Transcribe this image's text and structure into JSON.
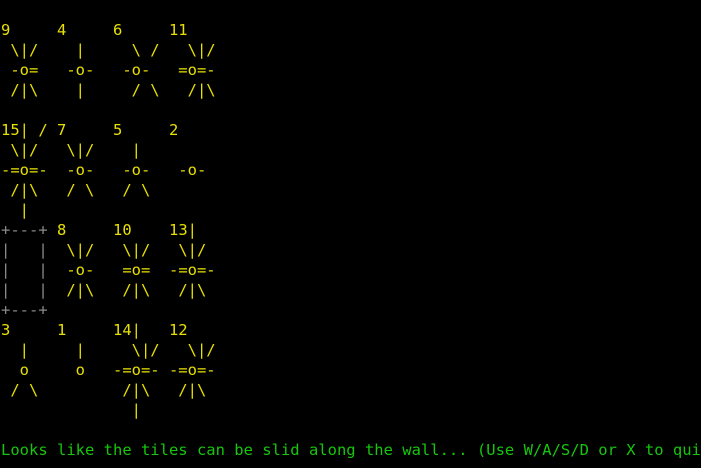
{
  "colors": {
    "background": "#000000",
    "tile_text": "#e8e000",
    "wall": "#8a8a8a",
    "status_text": "#16c60c"
  },
  "board": {
    "rows": [
      [
        {
          "text": "9     4     6     11",
          "type": "tile"
        },
        {
          "text": " \\|/    |     \\ /   \\|/",
          "type": "tile"
        },
        {
          "text": " -o=   -o-   -o-   =o=-",
          "type": "tile"
        },
        {
          "text": " /|\\    |     / \\   /|\\",
          "type": "tile"
        },
        {
          "text": "",
          "type": "tile"
        }
      ],
      [
        {
          "text": "15| / 7     5     2",
          "type": "tile"
        },
        {
          "text": " \\|/   \\|/    |",
          "type": "tile"
        },
        {
          "text": "-=o=-  -o-   -o-   -o-",
          "type": "tile"
        },
        {
          "text": " /|\\   / \\   / \\",
          "type": "tile"
        },
        {
          "text": "  |",
          "type": "tile"
        }
      ],
      [
        {
          "text": "+---+",
          "type": "wall",
          "rest": " 8     10    13|"
        },
        {
          "text": "|   |",
          "type": "wall",
          "rest": "  \\|/   \\|/   \\|/"
        },
        {
          "text": "|   |",
          "type": "wall",
          "rest": "  -o-   =o=  -=o=-"
        },
        {
          "text": "|   |",
          "type": "wall",
          "rest": "  /|\\   /|\\   /|\\"
        },
        {
          "text": "+---+",
          "type": "wall",
          "rest": ""
        }
      ],
      [
        {
          "text": "3     1     14|   12",
          "type": "tile"
        },
        {
          "text": "  |     |     \\|/   \\|/",
          "type": "tile"
        },
        {
          "text": "  o     o   -=o=- -=o=-",
          "type": "tile"
        },
        {
          "text": " / \\         /|\\   /|\\",
          "type": "tile"
        },
        {
          "text": "              |",
          "type": "tile"
        }
      ]
    ]
  },
  "status": {
    "message": "Looks like the tiles can be slid along the wall... (Use W/A/S/D or X to quit)"
  }
}
